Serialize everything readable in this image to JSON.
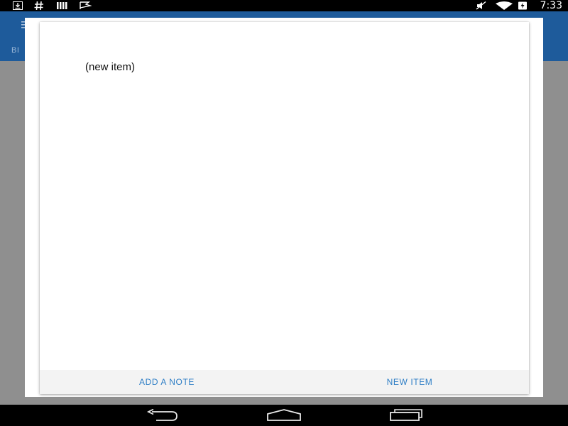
{
  "status_bar": {
    "time": "7:33",
    "left_icons": [
      "download-icon",
      "hash-icon",
      "signal-bars-icon",
      "flag-icon"
    ],
    "right_icons": [
      "mute-icon",
      "wifi-icon",
      "battery-icon"
    ]
  },
  "app": {
    "toolbar_color": "#1e5b9b",
    "tab_partial": "BI"
  },
  "dialog": {
    "item_text": "(new item)",
    "buttons": {
      "add_note": "ADD A NOTE",
      "new_item": "NEW ITEM"
    },
    "accent_color": "#2f7fc6"
  },
  "nav_bar": {
    "buttons": [
      "back-icon",
      "home-icon",
      "recents-icon"
    ]
  }
}
